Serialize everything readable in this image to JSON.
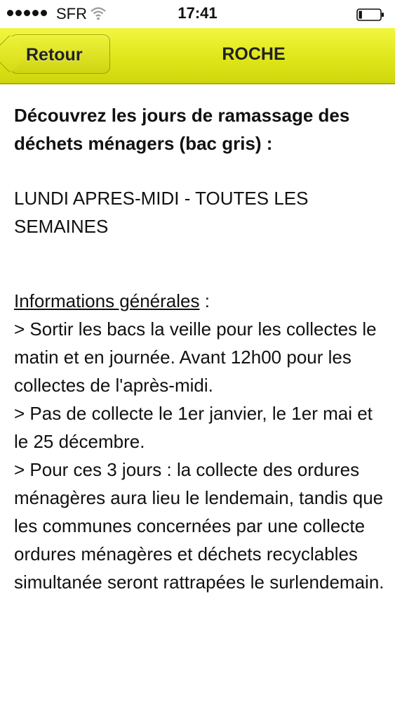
{
  "status_bar": {
    "carrier": "SFR",
    "time": "17:41",
    "signal_dots": 5,
    "battery_level": 0.15
  },
  "nav": {
    "back_label": "Retour",
    "title": "ROCHE",
    "bar_color": "#dfe61a"
  },
  "content": {
    "heading": "Découvrez les jours de ramassage des déchets ménagers (bac gris) :",
    "schedule": "LUNDI APRES-MIDI - TOUTES LES SEMAINES",
    "info_title": "Informations générales",
    "info_title_suffix": " :",
    "info_lines": [
      "> Sortir les bacs la veille pour les collectes le matin et en journée. Avant 12h00 pour les collectes de l'après-midi.",
      "> Pas de collecte le 1er janvier, le 1er mai et le 25 décembre.",
      "> Pour ces 3 jours : la collecte des ordures ménagères aura lieu le lendemain, tandis que les communes concernées par une collecte ordures ménagères et déchets recyclables simultanée seront rattrapées le surlendemain."
    ]
  }
}
